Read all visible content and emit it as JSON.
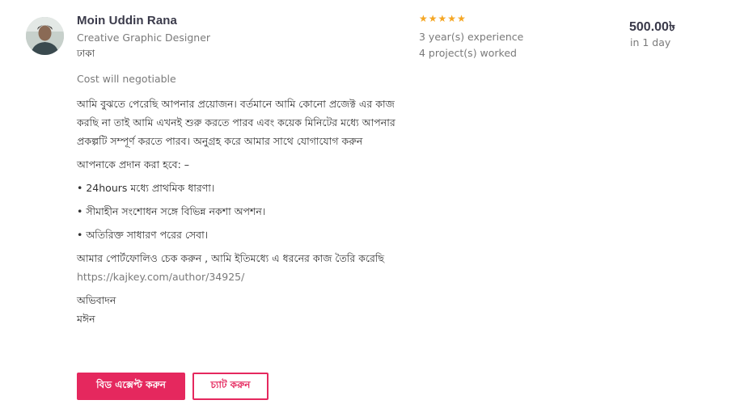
{
  "freelancer": {
    "name": "Moin Uddin Rana",
    "role": "Creative Graphic Designer",
    "location": "ঢাকা",
    "rating": 5,
    "experience": "3 year(s) experience",
    "projects": "4 project(s) worked"
  },
  "bid": {
    "price": "500.00৳",
    "delivery": "in 1 day",
    "cost_note": "Cost will negotiable"
  },
  "message": {
    "intro": "আমি বুঝতে পেরেছি আপনার প্রয়োজন। বর্তমানে আমি কোনো প্রজেক্ট এর কাজ করছি না তাই আমি এখনই শুরু করতে পারব এবং কয়েক মিনিটের মধ্যে আপনার প্রকল্পটি সম্পূর্ণ করতে পারব। অনুগ্রহ করে আমার সাথে যোগাযোগ করুন",
    "offer_heading": "আপনাকে প্রদান করা হবে: –",
    "offer_items": [
      "• 24hours মধ্যে প্রাথমিক ধারণা।",
      "• সীমাহীন সংশোধন সঙ্গে বিভিন্ন নকশা অপশন।",
      "• অতিরিক্ত সাধারণ পরের সেবা।"
    ],
    "portfolio_text": "আমার পোর্টফোলিও চেক করুন , আমি ইতিমধ্যে এ ধরনের কাজ তৈরি করেছি",
    "portfolio_link": "https://kajkey.com/author/34925/",
    "greeting": "অভিবাদন",
    "signature": "মঈন"
  },
  "actions": {
    "accept_bid": "বিড এক্সেপ্ট করুন",
    "chat": "চ্যাট করুন"
  },
  "colors": {
    "accent": "#e5285e",
    "star": "#f5a623"
  }
}
